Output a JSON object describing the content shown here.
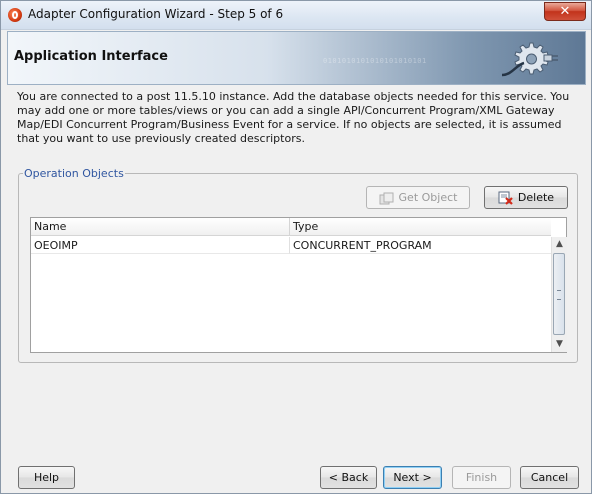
{
  "window": {
    "title": "Adapter Configuration Wizard - Step 5 of 6",
    "close_glyph": "✕"
  },
  "header": {
    "title": "Application Interface",
    "binary_text": "0101010101010101010101",
    "icon": "gear-plug-icon"
  },
  "description": "You are connected to a post 11.5.10 instance. Add the database objects needed for this service. You may add one or more tables/views or you can add a single API/Concurrent Program/XML Gateway Map/EDI Concurrent Program/Business Event for a service. If no objects are selected, it is assumed that you want to use previously created descriptors.",
  "operation_objects": {
    "legend": "Operation Objects",
    "get_object_label": "Get Object",
    "delete_label": "Delete",
    "table": {
      "columns": [
        "Name",
        "Type"
      ],
      "rows": [
        {
          "name": "OEOIMP",
          "type": "CONCURRENT_PROGRAM"
        }
      ]
    }
  },
  "footer": {
    "help_label": "Help",
    "back_label": "< Back",
    "next_label": "Next >",
    "finish_label": "Finish",
    "cancel_label": "Cancel"
  },
  "colors": {
    "legend": "#3056a0",
    "close_button": "#c2331b",
    "header_dark": "#5e7895"
  }
}
